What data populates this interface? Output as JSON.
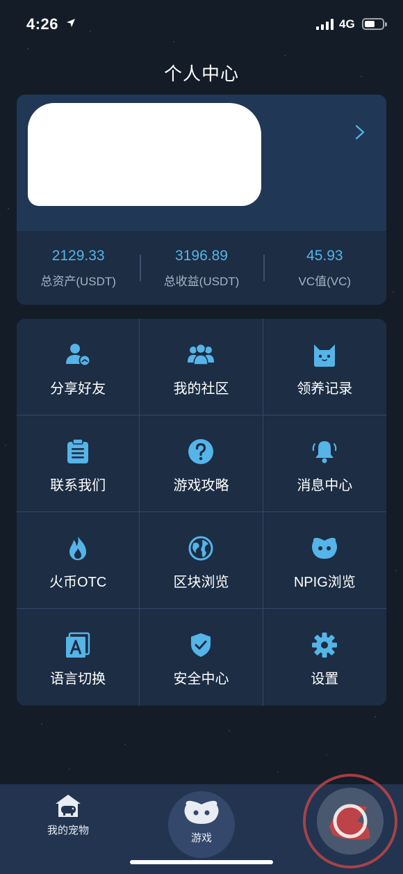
{
  "status_bar": {
    "time": "4:26",
    "network": "4G"
  },
  "header": {
    "title": "个人中心"
  },
  "profile": {
    "stats": [
      {
        "value": "2129.33",
        "label": "总资产(USDT)"
      },
      {
        "value": "3196.89",
        "label": "总收益(USDT)"
      },
      {
        "value": "45.93",
        "label": "VC值(VC)"
      }
    ]
  },
  "menu": [
    {
      "label": "分享好友",
      "icon": "share-friends-icon"
    },
    {
      "label": "我的社区",
      "icon": "community-icon"
    },
    {
      "label": "领养记录",
      "icon": "adoption-record-icon"
    },
    {
      "label": "联系我们",
      "icon": "clipboard-icon"
    },
    {
      "label": "游戏攻略",
      "icon": "question-icon"
    },
    {
      "label": "消息中心",
      "icon": "bell-icon"
    },
    {
      "label": "火币OTC",
      "icon": "flame-icon"
    },
    {
      "label": "区块浏览",
      "icon": "globe-icon"
    },
    {
      "label": "NPIG浏览",
      "icon": "pig-face-icon"
    },
    {
      "label": "语言切换",
      "icon": "language-icon"
    },
    {
      "label": "安全中心",
      "icon": "shield-check-icon"
    },
    {
      "label": "设置",
      "icon": "gear-icon"
    }
  ],
  "tab_bar": {
    "pets_label": "我的宠物",
    "game_label": "游戏"
  },
  "colors": {
    "accent": "#55b4e8",
    "card": "#1c2d44",
    "background": "#141c28"
  }
}
